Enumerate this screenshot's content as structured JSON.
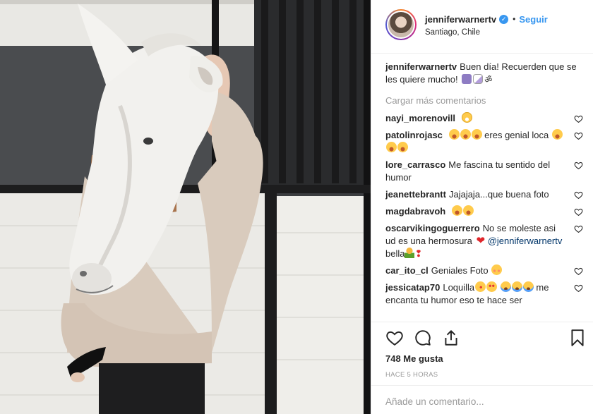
{
  "photo": {
    "alt_icon": "photo-horse-mask"
  },
  "header": {
    "username": "jenniferwarnertv",
    "verified_icon": "verified-badge-icon",
    "separator": "•",
    "follow_label": "Seguir",
    "location": "Santiago, Chile"
  },
  "caption": {
    "user": "jenniferwarnertv",
    "text": "Buen día! Recuerden que se les quiere mucho!"
  },
  "load_more": "Cargar más comentarios",
  "comments": [
    {
      "user": "nayi_morenovill",
      "text": ""
    },
    {
      "user": "patolinrojasc",
      "text_before": "",
      "text": "eres genial loca"
    },
    {
      "user": "lore_carrasco",
      "text": "Me fascina tu sentido del humor"
    },
    {
      "user": "jeanettebrantt",
      "text": "Jajajaja...que buena foto"
    },
    {
      "user": "magdabravoh",
      "text": ""
    },
    {
      "user": "oscarvikingoguerrero",
      "text": "No se moleste asi ud es una hermosura",
      "mention": "@jenniferwarnertv",
      "text2": "bella"
    },
    {
      "user": "car_ito_cl",
      "text": "Geniales Foto"
    },
    {
      "user": "jessicatap70",
      "text": "Loquilla",
      "text2": "me encanta tu humor eso te hace ser"
    }
  ],
  "actions": {
    "like_icon": "heart-icon",
    "comment_icon": "comment-icon",
    "share_icon": "share-icon",
    "save_icon": "bookmark-icon"
  },
  "likes": "748 Me gusta",
  "timestamp": "HACE 5 HORAS",
  "add_comment": {
    "placeholder": "Añade un comentario..."
  },
  "colors": {
    "link": "#3897f0",
    "text": "#262626",
    "muted": "#999999",
    "border": "#efefef"
  }
}
